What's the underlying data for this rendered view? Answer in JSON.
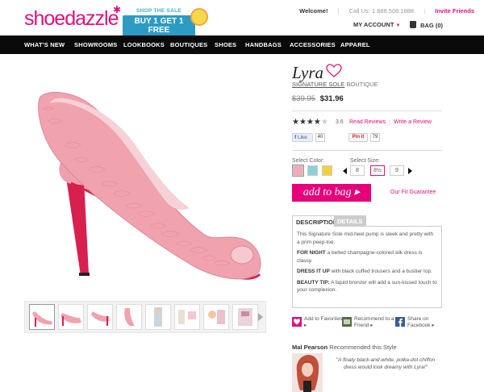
{
  "header": {
    "logo": "shoedazzle",
    "promo_line1": "SHOP THE SALE",
    "promo_line2": "BUY 1 GET 1 FREE",
    "welcome": "Welcome!",
    "call_us": "Call Us: 1.888.508.1888",
    "invite": "Invite Friends",
    "my_account": "MY ACCOUNT",
    "bag": "BAG (0)"
  },
  "nav": [
    "WHAT'S NEW",
    "SHOWROOMS",
    "LOOKBOOKS",
    "BOUTIQUES",
    "SHOES",
    "HANDBAGS",
    "ACCESSORIES",
    "APPAREL"
  ],
  "product": {
    "name": "Lyra",
    "brand_link": "SIGNATURE SOLE",
    "brand_suffix": " BOUTIQUE",
    "old_price": "$39.95",
    "new_price": "$31.96",
    "rating_value": 3.6,
    "rating_text": "3.6",
    "stars_max": 5,
    "read_reviews": "Read Reviews",
    "write_review": "Write a Review",
    "fb_like": "Like",
    "fb_count": "40",
    "pin_label": "Pin it",
    "pin_count": "79",
    "select_color_label": "Select Color:",
    "colors": [
      "#f4a9b7",
      "#8ecfd6",
      "#f2d23c"
    ],
    "select_size_label": "Select Size:",
    "sizes": [
      "8",
      "8½",
      "9"
    ],
    "active_size_index": 1,
    "add_to_bag": "add to bag ▸",
    "fit_guarantee": "Our Fit Guarantee"
  },
  "tabs": {
    "description": "DESCRIPTION",
    "details": "DETAILS"
  },
  "description": {
    "intro": "This Signature Sole mid-heel pump is sleek and pretty with a prim peep-toe.",
    "p1_label": "FOR NIGHT",
    "p1_text": " a belted champagne-colored silk dress is classy.",
    "p2_label": "DRESS IT UP",
    "p2_text": " with black cuffed trousers and a bustier top.",
    "p3_label": "BEAUTY TIP:",
    "p3_text": " A liquid bronzer will add a sun-kissed touch to your complexion."
  },
  "share": {
    "favorites": "Add to Favorites ▸",
    "recommend": "Recommend to a Friend ▸",
    "facebook": "Share on Facebook ▸"
  },
  "recommendation": {
    "name": "Mal Pearson",
    "suffix": " Recommended this Style",
    "quote": "\"A floaty black-and-white, polka-dot chiffon dress would look dreamy with Lyra!\""
  },
  "colors": {
    "brand_pink": "#e0107a",
    "nav_bg": "#0a0a0a",
    "shoe_pink": "#f0a3ae",
    "sole_red": "#d8204f"
  }
}
